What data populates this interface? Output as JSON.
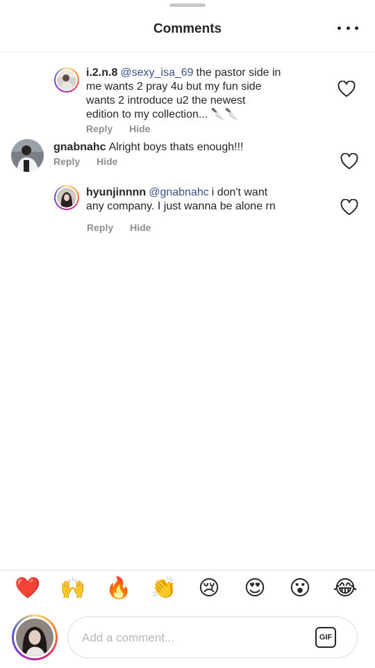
{
  "header": {
    "title": "Comments",
    "more_icon": "more-horizontal-icon"
  },
  "comments": [
    {
      "username": "i.2.n.8",
      "mention": "@sexy_isa_69",
      "lines": [
        "the pastor side in",
        "me wants 2 pray 4u but my fun side",
        "wants 2 introduce u2 the newest",
        "edition to my collection... 🔪🔪"
      ],
      "reply": "Reply",
      "hide": "Hide"
    },
    {
      "username": "gnabnahc",
      "mention": "",
      "lines": [
        "Alright boys thats enough!!!"
      ],
      "reply": "Reply",
      "hide": "Hide"
    },
    {
      "username": "hyunjinnnn",
      "mention": "@gnabnahc",
      "lines": [
        "i don't want",
        "any company. I just wanna be alone rn"
      ],
      "reply": "Reply",
      "hide": "Hide"
    }
  ],
  "quick_emojis": [
    "❤️",
    "🙌",
    "🔥",
    "👏",
    "😢",
    "😍",
    "😮",
    "😂"
  ],
  "composer": {
    "placeholder": "Add a comment...",
    "gif_label": "GIF"
  },
  "colors": {
    "mention": "#385185",
    "secondary_text": "#8e8e8e",
    "divider": "#dbdbdb"
  }
}
